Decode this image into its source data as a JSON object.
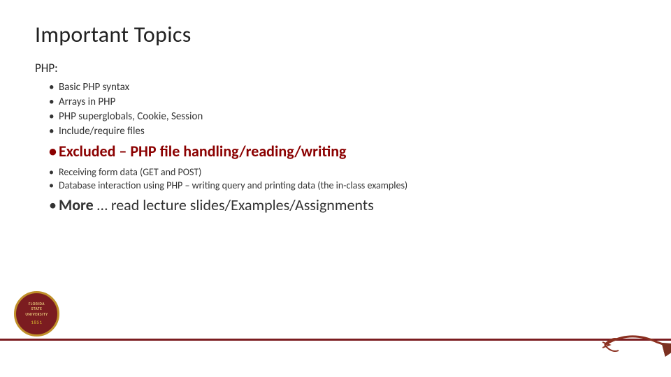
{
  "slide": {
    "title": "Important Topics",
    "php_label": "PHP:",
    "php_bullets": [
      "Basic PHP syntax",
      "Arrays in PHP",
      "PHP superglobals, Cookie, Session",
      "Include/require files"
    ],
    "excluded_text": "Excluded – PHP file handling/reading/writing",
    "form_bullets": [
      "Receiving form data (GET and POST)",
      "Database interaction using PHP – writing query and printing data (the in-class examples)"
    ],
    "more_text": "More … read lecture slides/Examples/Assignments",
    "more_bold": "More",
    "more_rest": " … read lecture slides/Examples/Assignments"
  },
  "logo": {
    "year": "1851",
    "seal_line1": "FLORIDA STATE",
    "seal_line2": "UNIVERSITY"
  },
  "colors": {
    "maroon": "#7B1C20",
    "gold": "#c0902a",
    "excluded_color": "#8B0000"
  }
}
